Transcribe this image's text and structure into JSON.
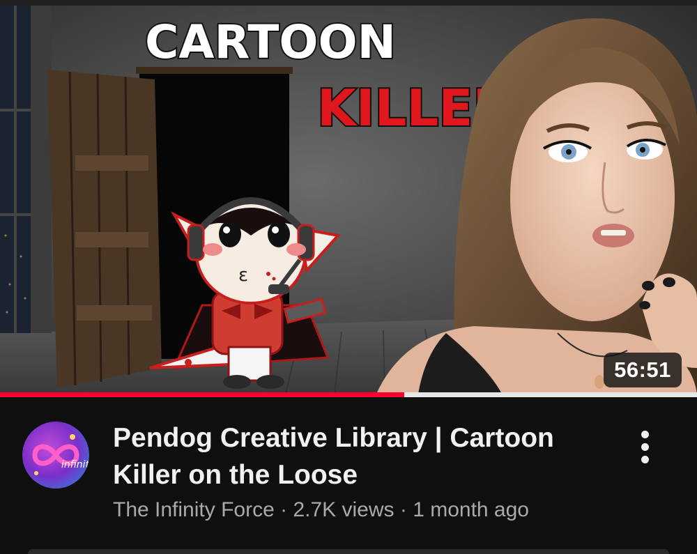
{
  "thumbnail": {
    "headline_line1": "CARTOON",
    "headline_line2": "KILLER",
    "duration": "56:51",
    "watch_progress": 0.58
  },
  "video": {
    "title": "Pendog Creative Library | Cartoon Killer on the Loose",
    "channel": "The Infinity Force",
    "views": "2.7K views",
    "age": "1 month ago",
    "separator": " · "
  },
  "avatar": {
    "label": "infinity"
  },
  "icons": {
    "more": "more-vert-icon"
  },
  "colors": {
    "progress": "#ff0033",
    "headline_red": "#e0171c",
    "background": "#0f0f0f"
  }
}
